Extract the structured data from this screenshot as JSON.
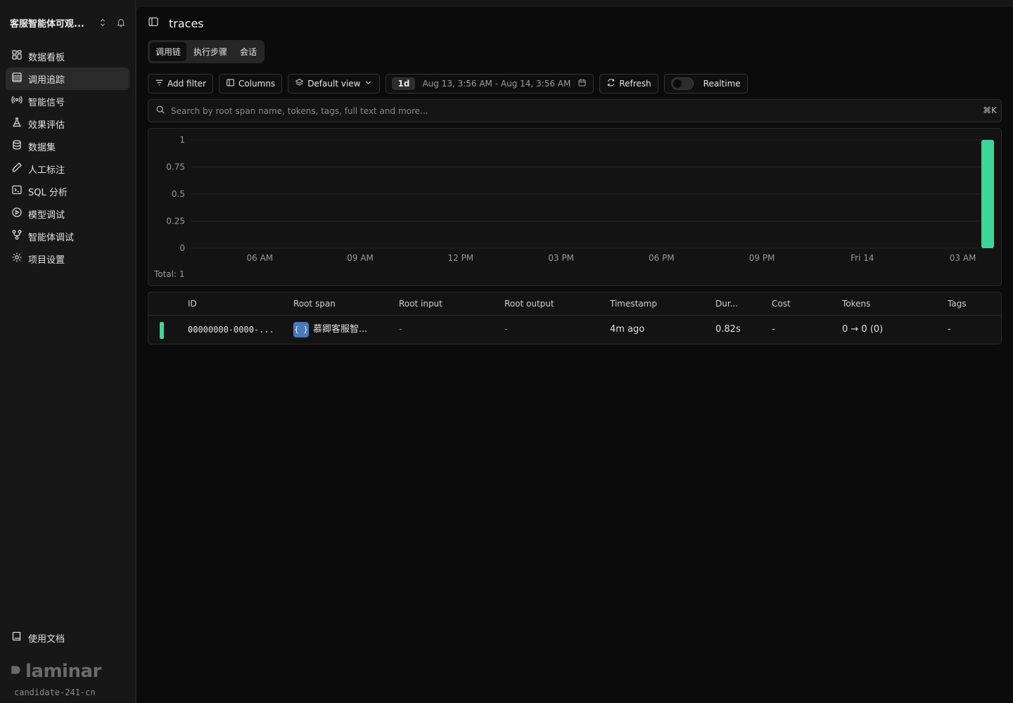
{
  "sidebar": {
    "project_name": "客服智能体可观...",
    "items": [
      {
        "label": "数据看板",
        "icon": "dashboard-icon"
      },
      {
        "label": "调用追踪",
        "icon": "table-list-icon",
        "active": true
      },
      {
        "label": "智能信号",
        "icon": "radio-signal-icon"
      },
      {
        "label": "效果评估",
        "icon": "flask-icon"
      },
      {
        "label": "数据集",
        "icon": "database-icon"
      },
      {
        "label": "人工标注",
        "icon": "pencil-icon"
      },
      {
        "label": "SQL 分析",
        "icon": "terminal-icon"
      },
      {
        "label": "模型调试",
        "icon": "play-circle-icon"
      },
      {
        "label": "智能体调试",
        "icon": "graph-nodes-icon"
      },
      {
        "label": "项目设置",
        "icon": "gear-icon"
      }
    ],
    "docs_label": "使用文档",
    "brand": "laminar",
    "candidate": "candidate-241-cn"
  },
  "header": {
    "title": "traces"
  },
  "tabs": [
    "调用链",
    "执行步骤",
    "会话"
  ],
  "toolbar": {
    "add_filter": "Add filter",
    "columns": "Columns",
    "view": "Default view",
    "range_pill": "1d",
    "range_text": "Aug 13, 3:56 AM - Aug 14, 3:56 AM",
    "refresh": "Refresh",
    "realtime": "Realtime",
    "realtime_on": false
  },
  "search": {
    "placeholder": "Search by root span name, tokens, tags, full text and more...",
    "shortcut": "⌘K"
  },
  "chart_data": {
    "type": "bar",
    "y_ticks": [
      "1",
      "0.75",
      "0.5",
      "0.25",
      "0"
    ],
    "ylim": [
      0,
      1
    ],
    "x_ticks": [
      "06 AM",
      "09 AM",
      "12 PM",
      "03 PM",
      "06 PM",
      "09 PM",
      "Fri 14",
      "03 AM"
    ],
    "bars": [
      {
        "x": "03:56 AM",
        "value": 1
      }
    ],
    "color": "#3ed598",
    "total": "Total: 1"
  },
  "table": {
    "columns": [
      "ID",
      "Root span",
      "Root input",
      "Root output",
      "Timestamp",
      "Dur...",
      "Cost",
      "Tokens",
      "Tags"
    ],
    "rows": [
      {
        "id": "00000000-0000-...",
        "root_span": "慕卿客服智...",
        "root_input": "-",
        "root_output": "-",
        "timestamp": "4m ago",
        "duration": "0.82s",
        "cost": "-",
        "tokens": "0 → 0 (0)",
        "tags": "-"
      }
    ]
  }
}
